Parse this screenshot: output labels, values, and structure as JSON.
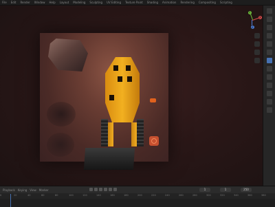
{
  "topbar": {
    "menus": [
      "File",
      "Edit",
      "Render",
      "Window",
      "Help",
      "Layout",
      "Modeling",
      "Sculpting",
      "UV Editing",
      "Texture Paint",
      "Shading",
      "Animation",
      "Rendering",
      "Compositing",
      "Scripting"
    ]
  },
  "gizmo": {
    "x_label": "X",
    "y_label": "Y",
    "z_label": "Z"
  },
  "timeline": {
    "menus": [
      "Playback",
      "Keying",
      "View",
      "Marker"
    ],
    "current_frame": "1",
    "start_frame": "1",
    "end_frame": "250",
    "ruler": [
      "0",
      "20",
      "40",
      "60",
      "80",
      "100",
      "120",
      "140",
      "160",
      "180",
      "200",
      "220",
      "240",
      "260",
      "280",
      "300",
      "320",
      "340",
      "360",
      "380"
    ]
  },
  "colors": {
    "accent": "#4772b3",
    "vehicle": "#f2b020",
    "cone": "#e0621e"
  }
}
